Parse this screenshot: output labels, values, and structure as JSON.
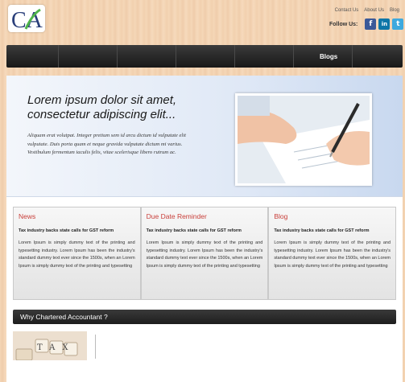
{
  "logo": {
    "text": "CA"
  },
  "toplinks": [
    "Contact Us",
    "About Us",
    "Blog"
  ],
  "social": {
    "label": "Follow Us:",
    "icons": [
      "f",
      "in",
      "t"
    ]
  },
  "nav": {
    "items": [
      "Blogs"
    ]
  },
  "hero": {
    "title": "Lorem ipsum dolor sit amet, consectetur adipiscing elit...",
    "text": "Aliquam erat volutpat. Integer pretium sem id arcu dictum id vulputate elit vulputate. Duis porta quam et neque gravida vulputate dictum mi varius. Vestibulum fermentum iaculis felis, vitae scelerisque libero rutrum ac."
  },
  "columns": [
    {
      "title": "News",
      "subtitle": "Tax industry backs state calls for GST reform",
      "text": "Lorem Ipsum is simply dummy text of the printing and typesetting industry. Lorem Ipsum has been the industry's standard dummy text ever since the 1500s, when an Lorem Ipsum is simply dummy text of the printing and typesetting"
    },
    {
      "title": "Due Date Reminder",
      "subtitle": "Tax industry backs state calls for GST reform",
      "text": "Lorem Ipsum is simply dummy text of the printing and typesetting industry. Lorem Ipsum has been the industry's standard dummy text ever since the 1500s, when an Lorem Ipsum is simply dummy text of the printing and typesetting"
    },
    {
      "title": "Blog",
      "subtitle": "Tax industry backs state calls for GST reform",
      "text": "Lorem Ipsum is simply dummy text of the printing and typesetting industry. Lorem Ipsum has been the industry's standard dummy text ever since the 1500s, when an Lorem Ipsum is simply dummy text of the printing and typesetting"
    }
  ],
  "why": {
    "title": "Why Chartered Accountant ?"
  },
  "tax_image": {
    "label": "TAX"
  },
  "colors": {
    "accent": "#c9403b",
    "facebook": "#3b5998",
    "linkedin": "#0e76a8",
    "twitter": "#3ea9de",
    "nav": "#1e1e1e"
  }
}
